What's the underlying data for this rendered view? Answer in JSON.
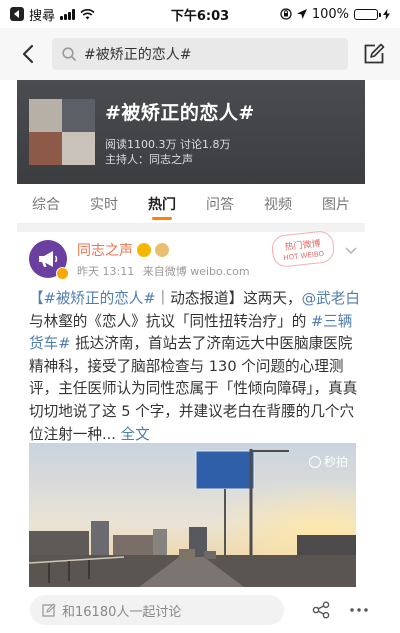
{
  "status_bar": {
    "carrier": "搜尋",
    "time": "下午6:03",
    "battery": "100%",
    "battery_level": 1.0
  },
  "nav": {
    "search_text": "#被矫正的恋人#"
  },
  "topic": {
    "title": "#被矫正的恋人#",
    "stats": "阅读1100.3万  讨论1.8万",
    "host": "主持人：同志之声"
  },
  "tabs": [
    {
      "label": "综合",
      "active": false
    },
    {
      "label": "实时",
      "active": false
    },
    {
      "label": "热门",
      "active": true
    },
    {
      "label": "问答",
      "active": false
    },
    {
      "label": "视频",
      "active": false
    },
    {
      "label": "图片",
      "active": false
    }
  ],
  "post": {
    "username": "同志之声",
    "time": "昨天 13:11",
    "source": "来自微博 weibo.com",
    "hot_stamp": "热门微博",
    "hot_stamp_sub": "HOT WEIBO",
    "body": {
      "tag1": "【#被矫正的恋人#",
      "t1": "｜动态报道】这两天，",
      "mention": "@武老白",
      "t2": "与林壑的《恋人》抗议「同性扭转治疗」的",
      "tag2": "#三辆货车#",
      "t3": "抵达济南，首站去了济南远大中医脑康医院精神科，接受了脑部检查与 130 个问题的心理测评，主任医师认为同性恋属于「性倾向障碍」，真真切切地说了这 5 个字，并建议老白在背腰的几个穴位注射一种...",
      "more": "全文"
    },
    "video_logo": "秒拍"
  },
  "bottom": {
    "comment_placeholder": "和16180人一起讨论"
  },
  "colors": {
    "accent": "#ff8200",
    "username": "#eb7350",
    "link": "#507daf"
  }
}
